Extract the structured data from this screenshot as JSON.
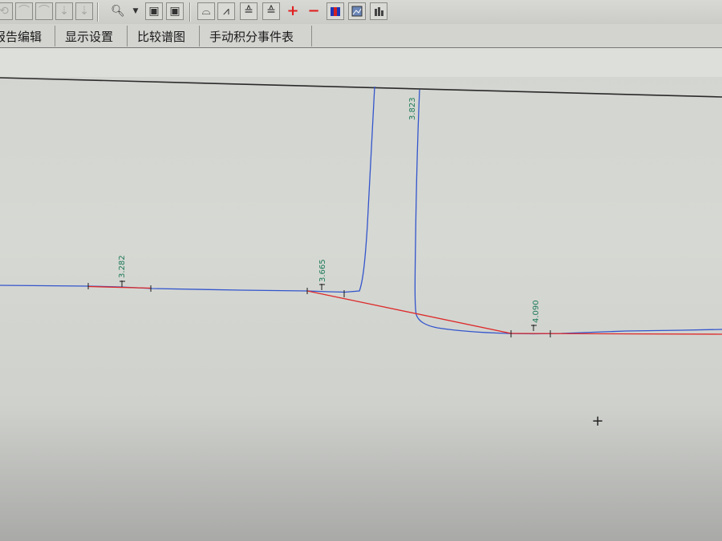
{
  "tabs": [
    {
      "label": "报告编辑"
    },
    {
      "label": "显示设置"
    },
    {
      "label": "比较谱图"
    },
    {
      "label": "手动积分事件表"
    }
  ],
  "toolbar": {
    "icons": [
      "undo-arrow-icon",
      "peak-icon",
      "peak-icon",
      "arrow-down-icon",
      "arrow-down-icon",
      "zoom-icon",
      "dropdown-arrow-icon",
      "frame-icon",
      "frame-icon",
      "open-folder-icon",
      "peak-icon",
      "stacked-peaks-icon",
      "stacked-peaks-icon",
      "plus-icon",
      "minus-icon",
      "color-bars-icon",
      "image-icon",
      "bars-icon"
    ]
  },
  "chromatogram": {
    "signal_color": "#3355cc",
    "baseline_color": "#dd2a2a",
    "label_color": "#1d7a5a",
    "peaks": [
      {
        "retention_time": "3.282"
      },
      {
        "retention_time": "3.665"
      },
      {
        "retention_time": "3.823"
      },
      {
        "retention_time": "4.090"
      }
    ]
  },
  "cursor": {
    "glyph": "+"
  }
}
